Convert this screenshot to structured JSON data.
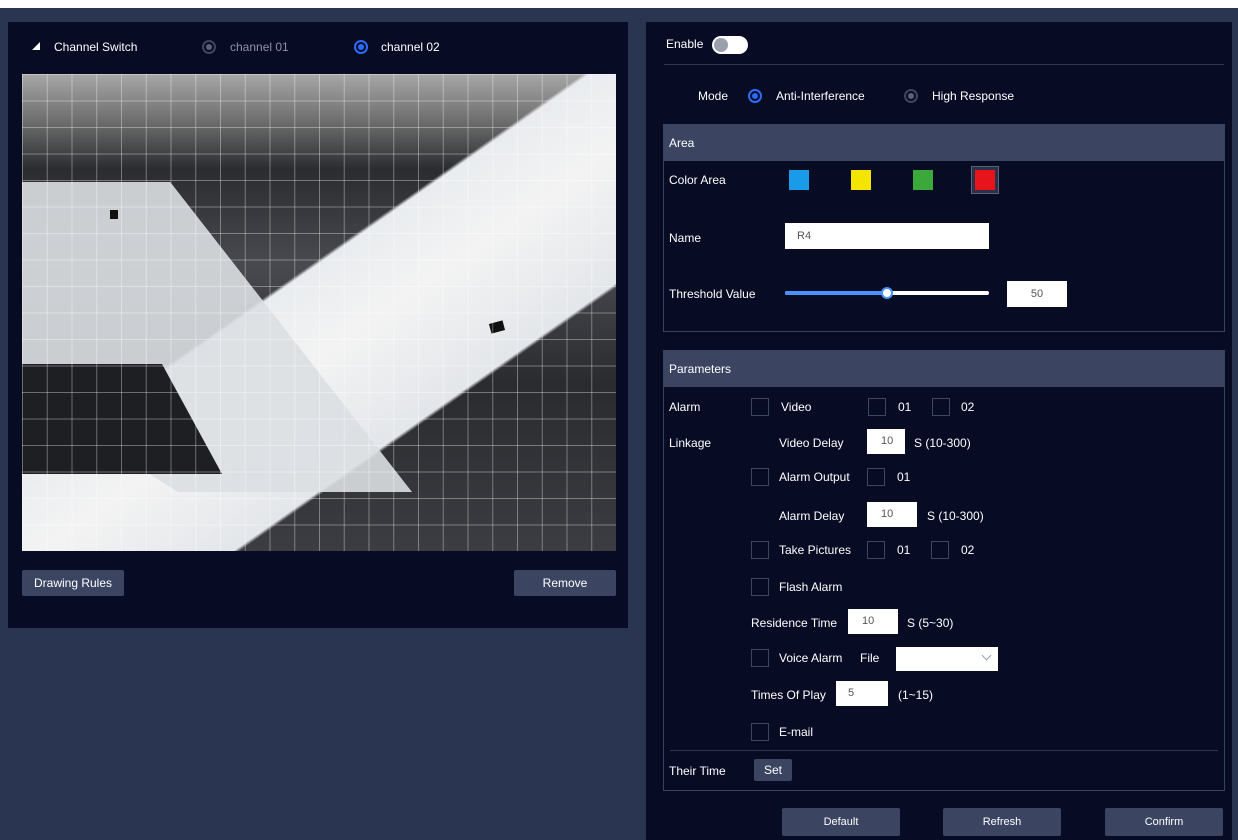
{
  "channel": {
    "switch_label": "Channel Switch",
    "options": [
      {
        "label": "channel 01",
        "selected": false
      },
      {
        "label": "channel 02",
        "selected": true
      }
    ]
  },
  "left_buttons": {
    "draw": "Drawing Rules",
    "remove": "Remove"
  },
  "enable": {
    "label": "Enable",
    "on": false
  },
  "mode": {
    "label": "Mode",
    "options": [
      {
        "label": "Anti-Interference",
        "selected": true
      },
      {
        "label": "High Response",
        "selected": false
      }
    ]
  },
  "area": {
    "title": "Area",
    "color_label": "Color Area",
    "colors": [
      "#1a9be8",
      "#f4e500",
      "#3aa83a",
      "#e8141c"
    ],
    "selected_color_index": 3,
    "name_label": "Name",
    "name_value": "R4",
    "threshold_label": "Threshold Value",
    "threshold_value": "50",
    "threshold_fraction": 0.5
  },
  "params": {
    "title": "Parameters",
    "alarm_label": "Alarm",
    "linkage_label": "Linkage",
    "video_label": "Video",
    "ch01": "01",
    "ch02": "02",
    "video_delay_label": "Video Delay",
    "video_delay_value": "10",
    "video_delay_range": "S (10-300)",
    "alarm_output_label": "Alarm Output",
    "alarm_output_ch": "01",
    "alarm_delay_label": "Alarm Delay",
    "alarm_delay_value": "10",
    "alarm_delay_range": "S (10-300)",
    "take_pictures_label": "Take Pictures",
    "flash_alarm_label": "Flash Alarm",
    "residence_label": "Residence Time",
    "residence_value": "10",
    "residence_range": "S (5~30)",
    "voice_alarm_label": "Voice Alarm",
    "file_label": "File",
    "file_value": "",
    "times_label": "Times Of Play",
    "times_value": "5",
    "times_range": "(1~15)",
    "email_label": "E-mail",
    "their_time_label": "Their Time",
    "set_label": "Set"
  },
  "footer": {
    "default": "Default",
    "refresh": "Refresh",
    "confirm": "Confirm"
  }
}
